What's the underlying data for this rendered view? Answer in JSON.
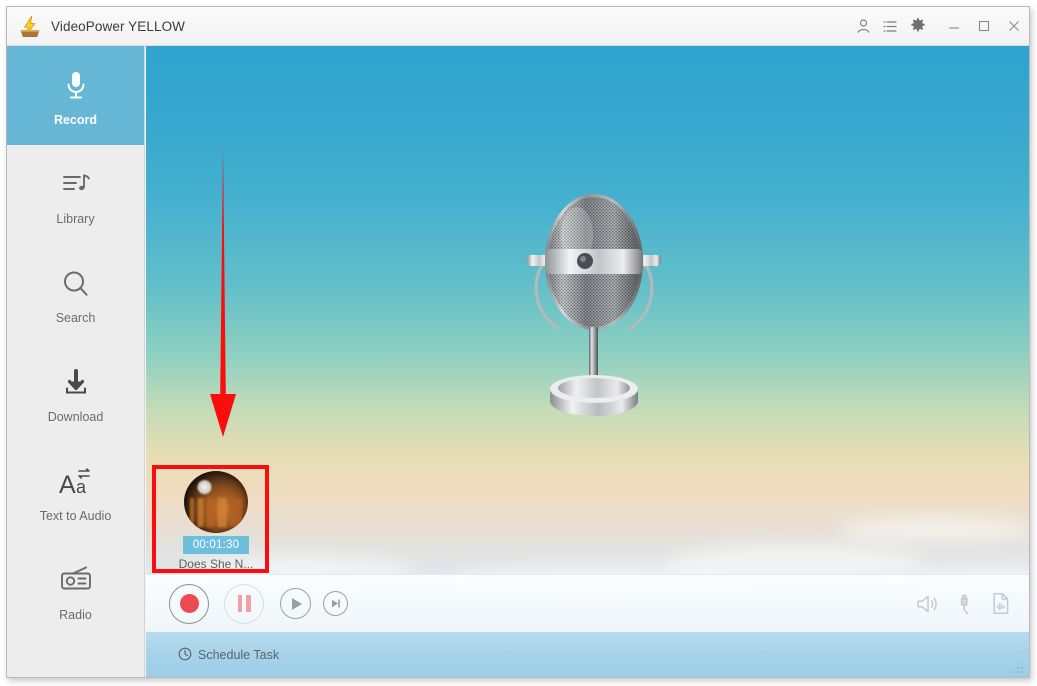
{
  "window": {
    "title": "VideoPower YELLOW",
    "app_icon": "lightning-bolt-icon",
    "titlebar_buttons": [
      {
        "name": "account-icon",
        "label": "Account"
      },
      {
        "name": "list-icon",
        "label": "List"
      },
      {
        "name": "gear-icon",
        "label": "Settings"
      }
    ],
    "window_buttons": [
      {
        "name": "minimize-button",
        "label": "Minimize"
      },
      {
        "name": "maximize-button",
        "label": "Maximize"
      },
      {
        "name": "close-button",
        "label": "Close"
      }
    ]
  },
  "sidebar": {
    "items": [
      {
        "label": "Record",
        "icon": "microphone-icon",
        "active": true
      },
      {
        "label": "Library",
        "icon": "music-list-icon",
        "active": false
      },
      {
        "label": "Search",
        "icon": "magnifier-icon",
        "active": false
      },
      {
        "label": "Download",
        "icon": "download-arrow-icon",
        "active": false
      },
      {
        "label": "Text to Audio",
        "icon": "text-swap-icon",
        "active": false
      },
      {
        "label": "Radio",
        "icon": "radio-icon",
        "active": false
      }
    ]
  },
  "stage": {
    "hero_icon": "vintage-microphone-illustration",
    "recording": {
      "duration": "00:01:30",
      "title": "Does She N...",
      "artwork": "album-art-thumbnail"
    },
    "annotation": {
      "type": "arrow-down",
      "color": "#fc0d0d",
      "highlight_color": "#fc0d0d"
    }
  },
  "controls": {
    "buttons": [
      {
        "name": "record-button",
        "label": "Record",
        "state": "enabled"
      },
      {
        "name": "pause-button",
        "label": "Pause",
        "state": "disabled"
      },
      {
        "name": "play-button",
        "label": "Play",
        "state": "enabled"
      },
      {
        "name": "next-button",
        "label": "Next",
        "state": "enabled"
      }
    ],
    "right_icons": [
      {
        "name": "speaker-icon",
        "label": "System Sound"
      },
      {
        "name": "microphone-jack-icon",
        "label": "Microphone Input"
      },
      {
        "name": "audio-file-icon",
        "label": "Audio File"
      }
    ]
  },
  "statusbar": {
    "schedule_label": "Schedule Task",
    "schedule_icon": "clock-icon"
  },
  "colors": {
    "accent": "#66b7d6",
    "record_red": "#ef4a52",
    "annotation_red": "#fc0d0d",
    "sidebar_bg": "#ededed",
    "badge_blue": "#6ebfdd"
  }
}
